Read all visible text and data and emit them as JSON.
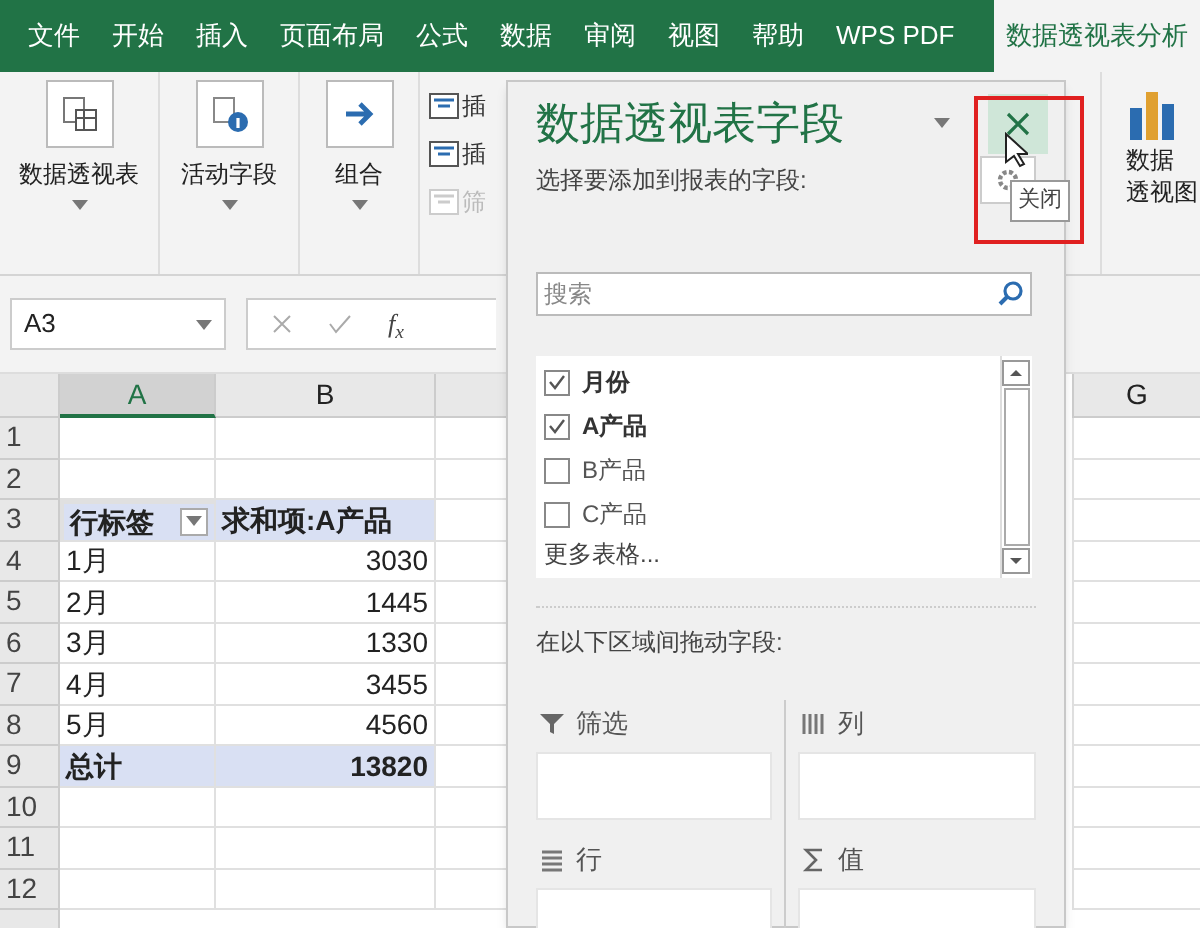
{
  "ribbon_tabs": [
    {
      "label": "文件",
      "selected": false
    },
    {
      "label": "开始",
      "selected": false
    },
    {
      "label": "插入",
      "selected": false
    },
    {
      "label": "页面布局",
      "selected": false
    },
    {
      "label": "公式",
      "selected": false
    },
    {
      "label": "数据",
      "selected": false
    },
    {
      "label": "审阅",
      "selected": false
    },
    {
      "label": "视图",
      "selected": false
    },
    {
      "label": "帮助",
      "selected": false
    },
    {
      "label": "WPS PDF",
      "selected": false
    },
    {
      "label": "数据透视表分析",
      "selected": true
    }
  ],
  "ribbon_groups": [
    {
      "label": "数据透视表",
      "kind": "pivot"
    },
    {
      "label": "活动字段",
      "kind": "field"
    },
    {
      "label": "组合",
      "kind": "group"
    }
  ],
  "ribbon_small_items": [
    {
      "label": "插",
      "disabled": false
    },
    {
      "label": "插",
      "disabled": false
    },
    {
      "label": "筛",
      "disabled": true
    }
  ],
  "ribbon_right_button": {
    "lines": [
      "数据",
      "透视图"
    ]
  },
  "name_box": "A3",
  "formula_fx": "f$_{x}$",
  "sheet": {
    "columns": [
      {
        "label": "A",
        "selected": true
      },
      {
        "label": "B",
        "selected": false
      }
    ],
    "last_column": "G",
    "rows": [
      {
        "number": "1",
        "kind": "blank"
      },
      {
        "number": "2",
        "kind": "blank"
      },
      {
        "number": "3",
        "kind": "header",
        "selected": true,
        "cells": [
          "行标签",
          "求和项:A产品"
        ]
      },
      {
        "number": "4",
        "kind": "data",
        "cells": [
          "1月",
          "3030"
        ]
      },
      {
        "number": "5",
        "kind": "data",
        "cells": [
          "2月",
          "1445"
        ]
      },
      {
        "number": "6",
        "kind": "data",
        "cells": [
          "3月",
          "1330"
        ]
      },
      {
        "number": "7",
        "kind": "data",
        "cells": [
          "4月",
          "3455"
        ]
      },
      {
        "number": "8",
        "kind": "data",
        "cells": [
          "5月",
          "4560"
        ]
      },
      {
        "number": "9",
        "kind": "total",
        "cells": [
          "总计",
          "13820"
        ]
      },
      {
        "number": "10",
        "kind": "blank"
      },
      {
        "number": "11",
        "kind": "blank"
      },
      {
        "number": "12",
        "kind": "blank"
      }
    ]
  },
  "pane": {
    "title": "数据透视表字段",
    "close_tooltip": "关闭",
    "subtitle": "选择要添加到报表的字段:",
    "search_placeholder": "搜索",
    "fields": [
      {
        "label": "月份",
        "checked": true
      },
      {
        "label": "A产品",
        "checked": true
      },
      {
        "label": "B产品",
        "checked": false
      },
      {
        "label": "C产品",
        "checked": false
      }
    ],
    "more_tables": "更多表格...",
    "areas_label": "在以下区域间拖动字段:",
    "areas": [
      {
        "label": "筛选",
        "kind": "filter"
      },
      {
        "label": "列",
        "kind": "columns"
      },
      {
        "label": "行",
        "kind": "rows"
      },
      {
        "label": "值",
        "kind": "values"
      }
    ]
  }
}
